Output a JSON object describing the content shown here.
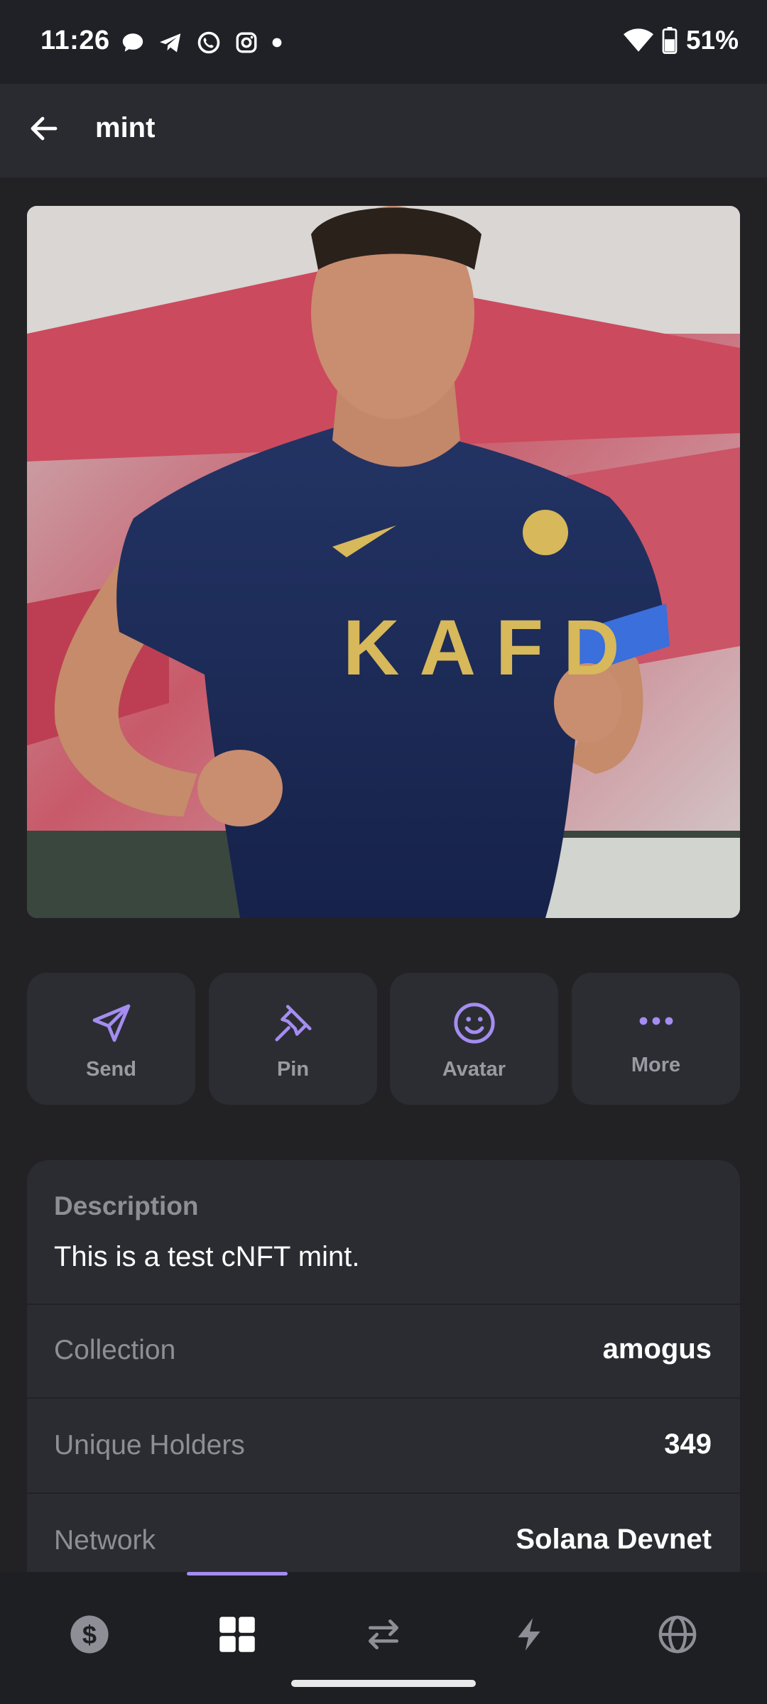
{
  "status_bar": {
    "time": "11:26",
    "battery": "51%",
    "notification_icons": [
      "chat-bubble-icon",
      "telegram-icon",
      "whatsapp-icon",
      "instagram-icon",
      "dot-icon"
    ]
  },
  "header": {
    "title": "mint"
  },
  "actions": [
    {
      "label": "Send",
      "icon": "send-icon"
    },
    {
      "label": "Pin",
      "icon": "pin-icon"
    },
    {
      "label": "Avatar",
      "icon": "smiley-icon"
    },
    {
      "label": "More",
      "icon": "more-dots-icon"
    }
  ],
  "details": {
    "description_heading": "Description",
    "description_text": "This is a test cNFT mint.",
    "rows": [
      {
        "label": "Collection",
        "value": "amogus"
      },
      {
        "label": "Unique Holders",
        "value": "349"
      },
      {
        "label": "Network",
        "value": "Solana Devnet"
      }
    ]
  },
  "bottom_nav": {
    "items": [
      "dollar-icon",
      "grid-icon",
      "swap-icon",
      "lightning-icon",
      "globe-icon"
    ],
    "active_index": 1
  },
  "colors": {
    "accent": "#a48df1",
    "background": "#222225",
    "card": "#2b2c31"
  }
}
